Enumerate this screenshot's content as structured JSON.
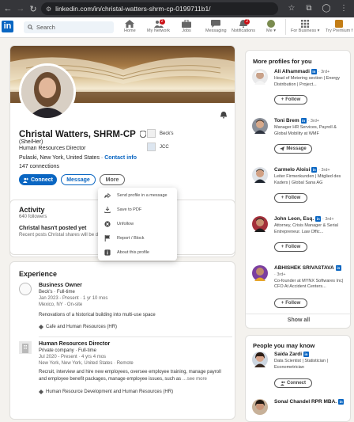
{
  "browser": {
    "url": "linkedin.com/in/christal-watters-shrm-cp-0199711b1/"
  },
  "nav": {
    "logo": "in",
    "search_placeholder": "Search",
    "items": [
      {
        "label": "Home",
        "badge": ""
      },
      {
        "label": "My Network",
        "badge": "2"
      },
      {
        "label": "Jobs",
        "badge": ""
      },
      {
        "label": "Messaging",
        "badge": ""
      },
      {
        "label": "Notifications",
        "badge": "2"
      },
      {
        "label": "Me ▾",
        "badge": ""
      },
      {
        "label": "For Business ▾",
        "badge": ""
      },
      {
        "label": "Try Premium f",
        "badge": ""
      }
    ]
  },
  "profile": {
    "name": "Christal Watters, SHRM-CP",
    "pronoun": "(She/Her)",
    "headline": "Human Resources Director",
    "location": "Pulaski, New York, United States",
    "contact_info": "Contact info",
    "connections": "147 connections",
    "companies": [
      "Beck's",
      "JCC"
    ],
    "buttons": {
      "connect": "Connect",
      "message": "Message",
      "more": "More"
    }
  },
  "more_menu": [
    {
      "label": "Send profile in a message",
      "icon": "send-icon"
    },
    {
      "label": "Save to PDF",
      "icon": "download-icon"
    },
    {
      "label": "Unfollow",
      "icon": "close-icon"
    },
    {
      "label": "Report / Block",
      "icon": "flag-icon"
    },
    {
      "label": "About this profile",
      "icon": "info-icon"
    }
  ],
  "activity": {
    "title": "Activity",
    "followers": "640 followers",
    "empty_title": "Christal hasn't posted yet",
    "empty_sub": "Recent posts Christal shares will be displayed here."
  },
  "experience": {
    "title": "Experience",
    "items": [
      {
        "title": "Business Owner",
        "company": "Beck's · Full-time",
        "dates": "Jan 2023 - Present · 1 yr 10 mos",
        "location": "Mexico, NY · On-site",
        "description": "Renovations of a historical building into multi-use space",
        "skills": "Cafe and Human Resources (HR)"
      },
      {
        "title": "Human Resources Director",
        "company": "Private company · Full-time",
        "dates": "Jul 2020 - Present · 4 yrs 4 mos",
        "location": "New York, New York, United States · Remote",
        "description": "Recruit, interview and hire new employees, oversee employee training, manage payroll and employee benefit packages, manage employee issues, such as",
        "see_more": "…see more",
        "skills": "Human Resource Development and Human Resources (HR)"
      }
    ]
  },
  "more_profiles": {
    "title": "More profiles for you",
    "people": [
      {
        "name": "Ali Alhammadi",
        "degree": "· 3rd+",
        "desc": "Head of Metering section | Energy Distribution | Project...",
        "action": "Follow"
      },
      {
        "name": "Toni Brem",
        "degree": "· 3rd+",
        "desc": "Manager HR Services, Payroll & Global Mobility at WMF",
        "action": "Message"
      },
      {
        "name": "Carmelo Aloisi",
        "degree": "· 3rd+",
        "desc": "Leiter Firmenkunden | Mitglied des Kaders | Global Sana AG",
        "action": "Follow"
      },
      {
        "name": "John Leon, Esq.",
        "degree": "· 3rd+",
        "desc": "Attorney, Crisis Manager & Serial Entrepreneur. Law Offic...",
        "action": "Follow"
      },
      {
        "name": "ABHISHEK SRIVASTAVA",
        "degree": "· 3rd+",
        "desc": "Co-founder at MYNX Softwares Inc| CFO At Accident Centers...",
        "action": "Follow"
      }
    ],
    "show_all": "Show all"
  },
  "people_you_may_know": {
    "title": "People you may know",
    "people": [
      {
        "name": "Saida Zardi",
        "desc": "Data Scientist | Statistician | Econometrician",
        "action": "Connect"
      },
      {
        "name": "Sonal Chandel RPR MBA.",
        "desc": "",
        "action": ""
      }
    ]
  },
  "colors": {
    "brand": "#0a66c2",
    "page_bg": "#f4f2ee",
    "badge": "#cc1016"
  }
}
